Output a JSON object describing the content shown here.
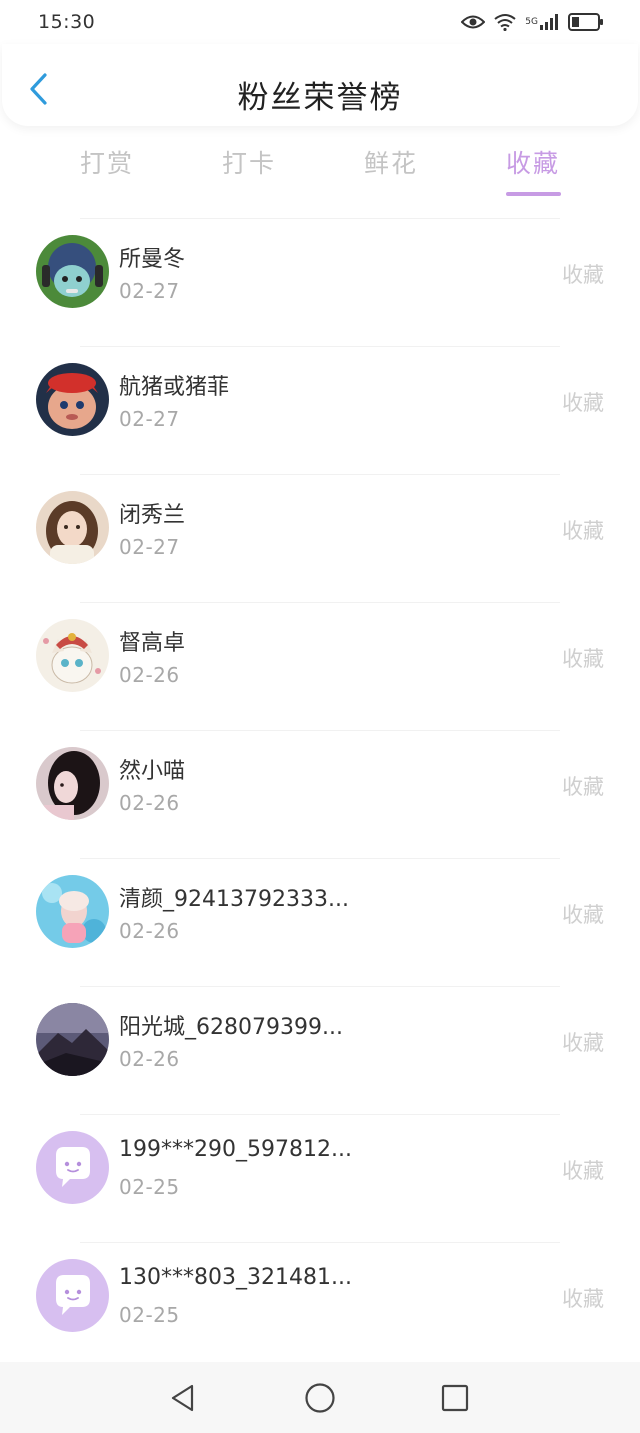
{
  "status_bar": {
    "time": "15:30",
    "network_label": "5G",
    "icons": [
      "eye-icon",
      "wifi-icon",
      "signal-icon",
      "battery-icon"
    ]
  },
  "header": {
    "back_icon": "chevron-left-icon",
    "title": "粉丝荣誉榜"
  },
  "tabs": [
    {
      "label": "打赏",
      "active": false
    },
    {
      "label": "打卡",
      "active": false
    },
    {
      "label": "鲜花",
      "active": false
    },
    {
      "label": "收藏",
      "active": true
    }
  ],
  "colors": {
    "accent": "#c79be4",
    "back_icon": "#2f9bdc",
    "inactive_tab": "#c4c4c4",
    "default_avatar_bg": "#d7bff0"
  },
  "list": [
    {
      "name": "所曼冬",
      "date": "02-27",
      "tag": "收藏",
      "avatar": "cartoon-green-avatar"
    },
    {
      "name": "航猪或猪菲",
      "date": "02-27",
      "tag": "收藏",
      "avatar": "cartoon-red-cap-avatar"
    },
    {
      "name": "闭秀兰",
      "date": "02-27",
      "tag": "收藏",
      "avatar": "photo-girl-avatar"
    },
    {
      "name": "督高卓",
      "date": "02-26",
      "tag": "收藏",
      "avatar": "cat-illustration-avatar"
    },
    {
      "name": "然小喵",
      "date": "02-26",
      "tag": "收藏",
      "avatar": "photo-dark-hair-avatar"
    },
    {
      "name": "清颜_92413792333...",
      "date": "02-26",
      "tag": "收藏",
      "avatar": "pool-photo-avatar"
    },
    {
      "name": "阳光城_628079399...",
      "date": "02-26",
      "tag": "收藏",
      "avatar": "mountain-photo-avatar"
    },
    {
      "name": "199***290_597812...",
      "date": "02-25",
      "tag": "收藏",
      "avatar": "default-chat-avatar"
    },
    {
      "name": "130***803_321481...",
      "date": "02-25",
      "tag": "收藏",
      "avatar": "default-chat-avatar"
    }
  ],
  "nav_bar": {
    "back": "triangle-back-icon",
    "home": "circle-home-icon",
    "recents": "square-recents-icon"
  }
}
